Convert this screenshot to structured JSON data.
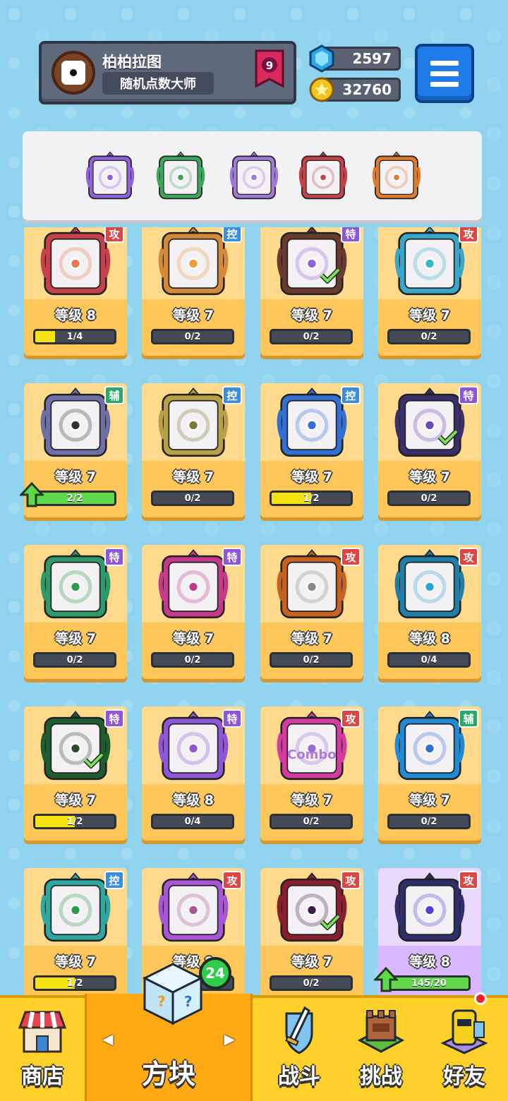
{
  "header": {
    "player_name": "柏柏拉图",
    "player_title": "随机点数大师",
    "rank": "9",
    "gems": "2597",
    "gold": "32760"
  },
  "deck": [
    {
      "name": "purple-dice",
      "color": "#8e62d9"
    },
    {
      "name": "green-dice",
      "color": "#3aa85a"
    },
    {
      "name": "lightning-dice",
      "color": "#9f7ad8"
    },
    {
      "name": "saw-dice",
      "color": "#c7414a"
    },
    {
      "name": "infinity-dice",
      "color": "#e07b2e"
    }
  ],
  "dice": [
    {
      "level": "等级 8",
      "progress": "1/4",
      "ratio": 0.25,
      "tag": "攻",
      "tag_color": "#e04545",
      "frame": "#c7414a",
      "dot": "#e77a4b",
      "check": false,
      "upgrade": false
    },
    {
      "level": "等级 7",
      "progress": "0/2",
      "ratio": 0,
      "tag": "控",
      "tag_color": "#3a8ee0",
      "frame": "#d48a3a",
      "dot": "#f09a3a",
      "check": false,
      "upgrade": false
    },
    {
      "level": "等级 7",
      "progress": "0/2",
      "ratio": 0,
      "tag": "特",
      "tag_color": "#8e55d6",
      "frame": "#6b3a2e",
      "dot": "#8e62d9",
      "check": true,
      "upgrade": false
    },
    {
      "level": "等级 7",
      "progress": "0/2",
      "ratio": 0,
      "tag": "攻",
      "tag_color": "#e04545",
      "frame": "#3aa6c8",
      "dot": "#36b7c8",
      "check": false,
      "upgrade": false
    },
    {
      "level": "等级 7",
      "progress": "2/2",
      "ratio": 1,
      "tag": "辅",
      "tag_color": "#2ea86a",
      "frame": "#6f6fa8",
      "dot": "#333333",
      "check": false,
      "upgrade": true
    },
    {
      "level": "等级 7",
      "progress": "0/2",
      "ratio": 0,
      "tag": "控",
      "tag_color": "#3a8ee0",
      "frame": "#b8a046",
      "dot": "#7a7a3a",
      "check": false,
      "upgrade": false
    },
    {
      "level": "等级 7",
      "progress": "1/2",
      "ratio": 0.5,
      "tag": "控",
      "tag_color": "#3a8ee0",
      "frame": "#2f6fd6",
      "dot": "#2f6fd6",
      "check": false,
      "upgrade": false
    },
    {
      "level": "等级 7",
      "progress": "0/2",
      "ratio": 0,
      "tag": "特",
      "tag_color": "#8e55d6",
      "frame": "#3a2e6b",
      "dot": "#6a4ab5",
      "check": true,
      "upgrade": false
    },
    {
      "level": "等级 7",
      "progress": "0/2",
      "ratio": 0,
      "tag": "特",
      "tag_color": "#8e55d6",
      "frame": "#2e9a6a",
      "dot": "#2e9a4a",
      "check": false,
      "upgrade": false
    },
    {
      "level": "等级 7",
      "progress": "0/2",
      "ratio": 0,
      "tag": "特",
      "tag_color": "#8e55d6",
      "frame": "#c43a8a",
      "dot": "#c43a8a",
      "check": false,
      "upgrade": false
    },
    {
      "level": "等级 7",
      "progress": "0/2",
      "ratio": 0,
      "tag": "攻",
      "tag_color": "#e04545",
      "frame": "#c8601e",
      "dot": "#888888",
      "check": false,
      "upgrade": false
    },
    {
      "level": "等级 8",
      "progress": "0/4",
      "ratio": 0,
      "tag": "攻",
      "tag_color": "#e04545",
      "frame": "#1f7fa8",
      "dot": "#2aa4d6",
      "check": false,
      "upgrade": false
    },
    {
      "level": "等级 7",
      "progress": "1/2",
      "ratio": 0.5,
      "tag": "特",
      "tag_color": "#8e55d6",
      "frame": "#1e5e2e",
      "dot": "#2e4a2e",
      "check": true,
      "upgrade": false
    },
    {
      "level": "等级 8",
      "progress": "0/4",
      "ratio": 0,
      "tag": "特",
      "tag_color": "#8e55d6",
      "frame": "#8e55d6",
      "dot": "#8e55d6",
      "check": false,
      "upgrade": false
    },
    {
      "level": "等级 7",
      "progress": "0/2",
      "ratio": 0,
      "tag": "攻",
      "tag_color": "#e04545",
      "frame": "#d43aa0",
      "dot": "#9a6ad8",
      "check": false,
      "upgrade": false,
      "art_text": "Combo"
    },
    {
      "level": "等级 7",
      "progress": "0/2",
      "ratio": 0,
      "tag": "辅",
      "tag_color": "#2ea86a",
      "frame": "#1f8ad6",
      "dot": "#2f6fd6",
      "check": false,
      "upgrade": false
    },
    {
      "level": "等级 7",
      "progress": "1/2",
      "ratio": 0.5,
      "tag": "控",
      "tag_color": "#3a8ee0",
      "frame": "#2ea8a0",
      "dot": "#2e9a4a",
      "check": false,
      "upgrade": false
    },
    {
      "level": "等级 8",
      "progress": "0/4",
      "ratio": 0,
      "tag": "攻",
      "tag_color": "#e04545",
      "frame": "#a855d6",
      "dot": "#a85590",
      "check": false,
      "upgrade": false
    },
    {
      "level": "等级 7",
      "progress": "0/2",
      "ratio": 0,
      "tag": "攻",
      "tag_color": "#e04545",
      "frame": "#8a1e2e",
      "dot": "#3a1e4a",
      "check": true,
      "upgrade": false
    },
    {
      "level": "等级 8",
      "progress": "145/20",
      "ratio": 1,
      "tag": "攻",
      "tag_color": "#e04545",
      "frame": "#2e2e6b",
      "dot": "#5a3ad8",
      "check": false,
      "upgrade": true,
      "purple": true
    }
  ],
  "nav": {
    "shop": "商店",
    "dice": "方块",
    "battle": "战斗",
    "challenge": "挑战",
    "friends": "好友",
    "dice_badge": "24"
  }
}
